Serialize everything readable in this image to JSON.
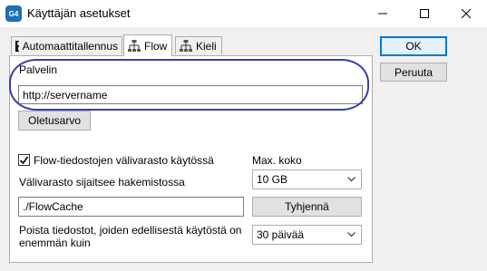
{
  "window": {
    "title": "Käyttäjän asetukset",
    "icon_text": "G4",
    "icon": "app-logo-icon"
  },
  "tabs": [
    {
      "label": "Automaattitallennus",
      "icon": "floppy-disk-icon",
      "active": false
    },
    {
      "label": "Flow",
      "icon": "network-flow-icon",
      "active": true
    },
    {
      "label": "Kieli",
      "icon": "network-flow-icon",
      "active": false
    }
  ],
  "side_buttons": {
    "ok": "OK",
    "cancel": "Peruuta"
  },
  "server": {
    "label": "Palvelin",
    "value": "http://servername",
    "default_button": "Oletusarvo"
  },
  "cache": {
    "enabled_label": "Flow-tiedostojen välivarasto käytössä",
    "enabled": true,
    "location_label": "Välivarasto sijaitsee hakemistossa",
    "location_value": "./FlowCache",
    "max_size_label": "Max. koko",
    "max_size_value": "10 GB",
    "clear_button": "Tyhjennä",
    "delete_label_line1": "Poista tiedostot, joiden edellisestä käytöstä on",
    "delete_label_line2": "enemmän kuin",
    "delete_value": "30 päivää"
  },
  "colors": {
    "highlight_ellipse": "#3a3fa8",
    "default_button_border": "#0078d7",
    "app_icon_bg": "#1f6fb5"
  }
}
